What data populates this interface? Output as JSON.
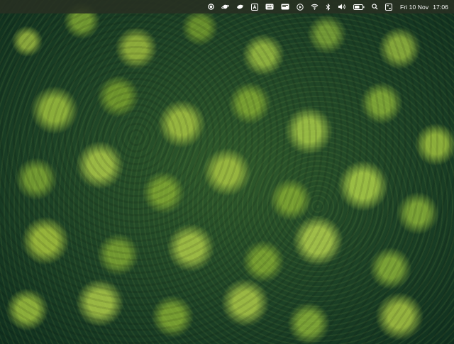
{
  "wallpaper": {
    "description_icon": "forest-wallpaper"
  },
  "menubar": {
    "status_icons": [
      "record-icon",
      "planet-icon",
      "bird-icon",
      "text-a-icon",
      "keyboard-icon",
      "display-icon",
      "play-icon",
      "wifi-icon",
      "bluetooth-icon",
      "volume-icon",
      "battery-icon",
      "search-icon",
      "control-center-icon"
    ],
    "date": "Fri 10 Nov",
    "time": "17:06"
  }
}
